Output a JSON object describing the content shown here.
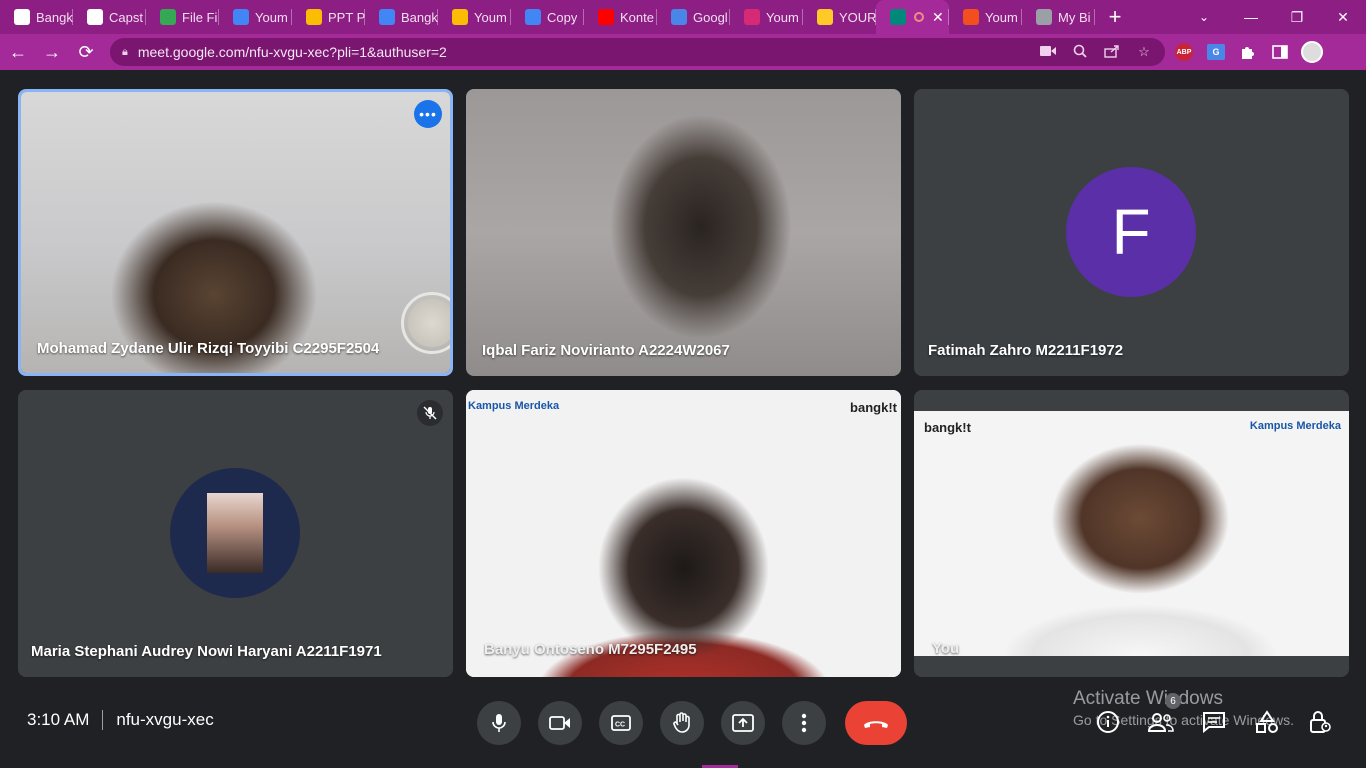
{
  "browser": {
    "tabs": [
      {
        "title": "Bangk",
        "favicon": "github-icon",
        "color": "#ffffff"
      },
      {
        "title": "Capst",
        "favicon": "github-icon",
        "color": "#ffffff"
      },
      {
        "title": "File Fi",
        "favicon": "google-drive-icon",
        "color": "#34a853"
      },
      {
        "title": "Youm",
        "favicon": "google-docs-icon",
        "color": "#4285f4"
      },
      {
        "title": "PPT P",
        "favicon": "google-slides-icon",
        "color": "#fbbc04"
      },
      {
        "title": "Bangk",
        "favicon": "google-docs-icon",
        "color": "#4285f4"
      },
      {
        "title": "Youm",
        "favicon": "google-slides-icon",
        "color": "#fbbc04"
      },
      {
        "title": "Copy",
        "favicon": "google-docs-icon",
        "color": "#4285f4"
      },
      {
        "title": "Konte",
        "favicon": "youtube-icon",
        "color": "#ff0000"
      },
      {
        "title": "Googl",
        "favicon": "google-translate-icon",
        "color": "#4a86e8"
      },
      {
        "title": "Youm",
        "favicon": "instagram-icon",
        "color": "#d62976"
      },
      {
        "title": "YOUR",
        "favicon": "firebase-icon",
        "color": "#ffca28"
      },
      {
        "title": "",
        "favicon": "google-meet-icon",
        "color": "#00897b",
        "active": true
      },
      {
        "title": "Youm",
        "favicon": "figma-icon",
        "color": "#f24e1e"
      },
      {
        "title": "My Bi",
        "favicon": "settings-icon",
        "color": "#9aa0a6"
      }
    ],
    "new_tab_label": "+",
    "url": "meet.google.com/nfu-xvgu-xec?pli=1&authuser=2"
  },
  "participants": [
    {
      "name": "Mohamad Zydane Ulir Rizqi Toyyibi C2295F2504",
      "type": "camera",
      "selected": true
    },
    {
      "name": "Iqbal Fariz Novirianto A2224W2067",
      "type": "camera"
    },
    {
      "name": "Fatimah Zahro M2211F1972",
      "type": "avatar",
      "initial": "F",
      "avatar_color": "#5b2fa8"
    },
    {
      "name": "Maria Stephani Audrey Nowi Haryani A2211F1971",
      "type": "photo-avatar",
      "muted": true
    },
    {
      "name": "Banyu Ontoseno M7295F2495",
      "type": "camera"
    },
    {
      "name": "You",
      "type": "camera"
    }
  ],
  "watermarks": {
    "bangkit": "bangk!t",
    "kampus": "Kampus Merdeka"
  },
  "meeting": {
    "time": "3:10 AM",
    "code": "nfu-xvgu-xec",
    "participant_count": "6"
  },
  "windows_notice": {
    "line1": "Activate Windows",
    "line2": "Go to Settings to activate Windows."
  },
  "colors": {
    "chrome_frame": "#8d1e83",
    "toolbar": "#a52a99",
    "meet_bg": "#202124",
    "tile_bg": "#3c4043",
    "end_call": "#ea4335",
    "selected_outline": "#8ab4f8"
  }
}
